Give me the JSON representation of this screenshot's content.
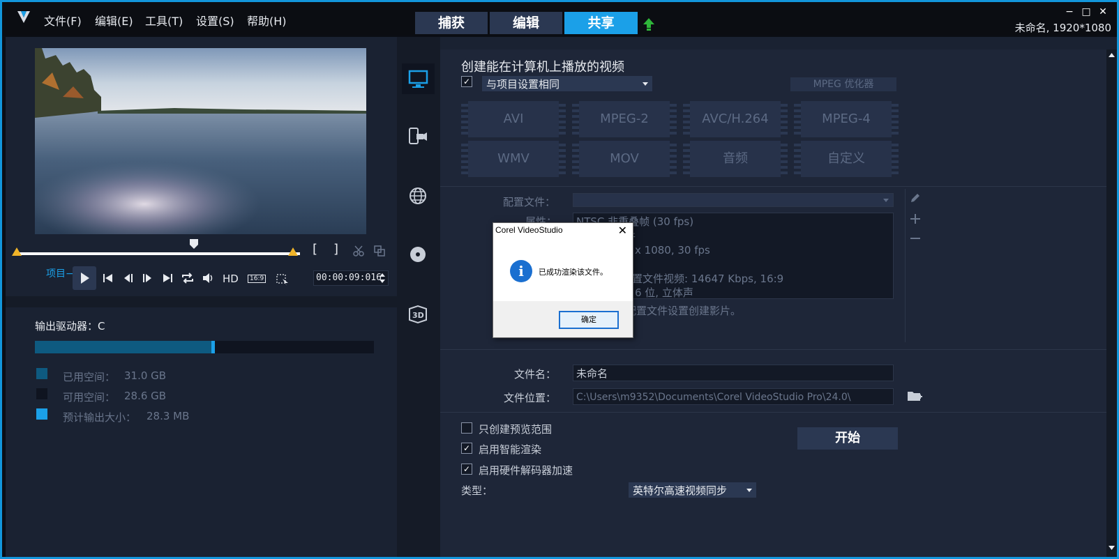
{
  "menu": [
    "文件(F)",
    "编辑(E)",
    "工具(T)",
    "设置(S)",
    "帮助(H)"
  ],
  "tabs": [
    "捕获",
    "编辑",
    "共享"
  ],
  "window_controls": [
    "−",
    "□",
    "✕"
  ],
  "project_info": "未命名, 1920*1080",
  "player": {
    "mode_label": "项目−",
    "hd_label": "HD",
    "aspect_label": "16:9",
    "timecode": "00:00:09:016",
    "mark_in": "[",
    "mark_out": "]"
  },
  "output": {
    "drive_label": "输出驱动器：C",
    "usage_fraction": 0.52,
    "legend": [
      {
        "label": "已用空间：",
        "value": "31.0 GB",
        "color": "#0e5a80"
      },
      {
        "label": "可用空间：",
        "value": "28.6 GB",
        "color": "#0f1420"
      },
      {
        "label": "预计输出大小：",
        "value": "28.3 MB",
        "color": "#1ba0e8"
      }
    ]
  },
  "share": {
    "heading": "创建能在计算机上播放的视频",
    "same_as_project": "与项目设置相同",
    "mpeg_optimizer": "MPEG 优化器",
    "formats_row1": [
      "AVI",
      "MPEG-2",
      "AVC/H.264",
      "MPEG-4"
    ],
    "formats_row2": [
      "WMV",
      "MOV",
      "音频",
      "自定义"
    ],
    "profile_label": "配置文件：",
    "attributes_label": "属性：",
    "attributes_lines": [
      "NTSC 非重叠帧 (30 fps)",
      "件",
      "x 1080, 30 fps",
      "",
      "置文件视频: 14647 Kbps, 16:9",
      "6 位, 立体声"
    ],
    "note": "配置文件设置创建影片。",
    "filename_label": "文件名：",
    "filename_value": "未命名",
    "location_label": "文件位置：",
    "location_value": "C:\\Users\\m9352\\Documents\\Corel VideoStudio Pro\\24.0\\",
    "opt_preview_range": "只创建预览范围",
    "opt_smart_render": "启用智能渲染",
    "opt_hw_decoder": "启用硬件解码器加速",
    "type_label": "类型：",
    "type_value": "英特尔高速视频同步",
    "start_button": "开始"
  },
  "dialog": {
    "title": "Corel VideoStudio",
    "close": "✕",
    "message": "已成功渲染该文件。",
    "ok": "确定"
  },
  "colors": {
    "accent": "#1ba0e8",
    "border": "#1296db",
    "panel": "#1a2232"
  }
}
